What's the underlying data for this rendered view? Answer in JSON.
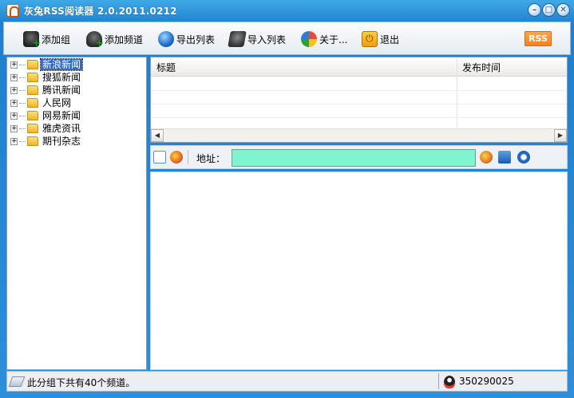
{
  "window": {
    "title": "灰兔RSS阅读器 2.0.2011.0212",
    "controls": {
      "minimize": "–",
      "maximize": "□",
      "close": "✕"
    }
  },
  "toolbar": {
    "buttons": [
      {
        "label": "添加组",
        "icon": "add-group-icon"
      },
      {
        "label": "添加频道",
        "icon": "add-channel-icon"
      },
      {
        "label": "导出列表",
        "icon": "export-globe-icon"
      },
      {
        "label": "导入列表",
        "icon": "import-printer-icon"
      },
      {
        "label": "关于...",
        "icon": "about-windows-icon"
      },
      {
        "label": "退出",
        "icon": "power-exit-icon"
      }
    ],
    "rss_badge": "RSS"
  },
  "tree": {
    "items": [
      {
        "label": "新浪新闻",
        "selected": true,
        "expander": "+"
      },
      {
        "label": "搜狐新闻",
        "selected": false,
        "expander": "+"
      },
      {
        "label": "腾讯新闻",
        "selected": false,
        "expander": "+"
      },
      {
        "label": "人民网",
        "selected": false,
        "expander": "+"
      },
      {
        "label": "网易新闻",
        "selected": false,
        "expander": "+"
      },
      {
        "label": "雅虎资讯",
        "selected": false,
        "expander": "+"
      },
      {
        "label": "期刊杂志",
        "selected": false,
        "expander": "+"
      }
    ]
  },
  "list": {
    "columns": [
      "标题",
      "发布时间"
    ],
    "scroll_left": "◀",
    "scroll_right": "▶"
  },
  "address_bar": {
    "label": "地址：",
    "value": ""
  },
  "status": {
    "message": "此分组下共有40个频道。",
    "qq_number": "350290025"
  },
  "colors": {
    "titlebar": "#1f7fcf",
    "address_input_bg": "#7ff5cf",
    "selection": "#316ac5",
    "rss_badge": "#ff7f1a"
  }
}
